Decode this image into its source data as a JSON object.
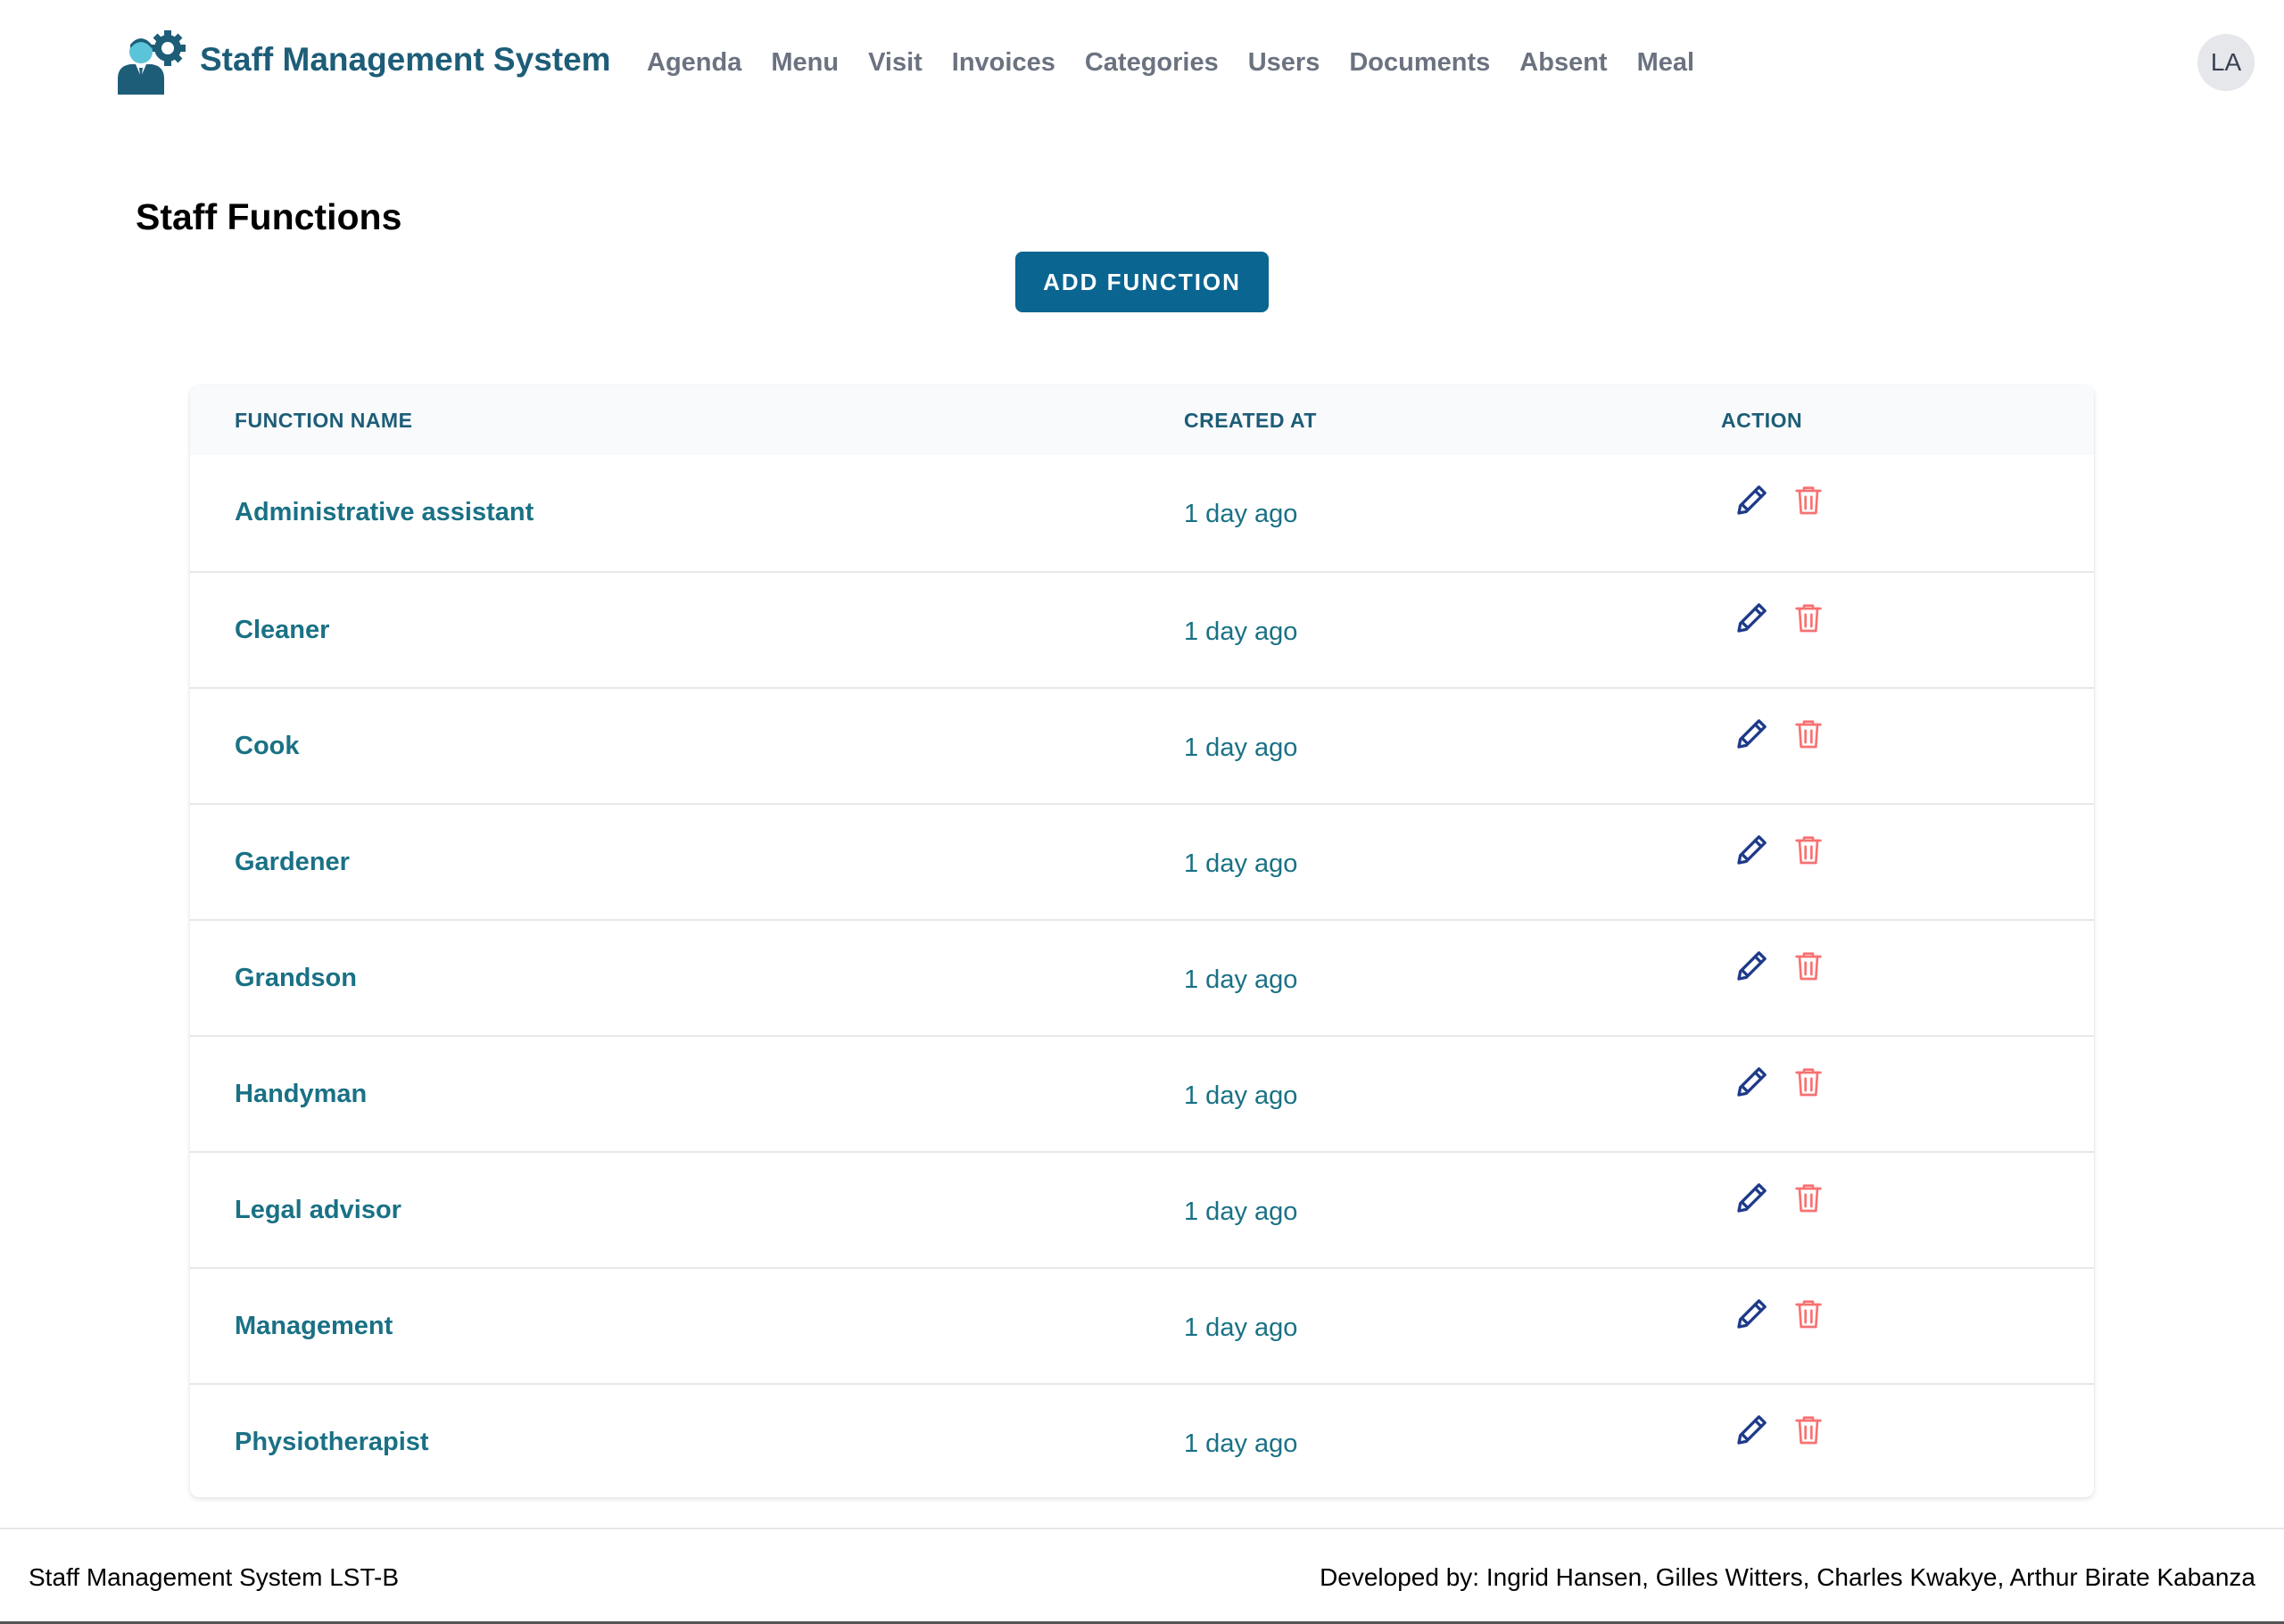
{
  "header": {
    "brand": "Staff Management System",
    "nav": [
      "Agenda",
      "Menu",
      "Visit",
      "Invoices",
      "Categories",
      "Users",
      "Documents",
      "Absent",
      "Meal"
    ],
    "avatar_initials": "LA"
  },
  "main": {
    "title": "Staff Functions",
    "add_button": "ADD FUNCTION",
    "table": {
      "columns": [
        "FUNCTION NAME",
        "CREATED AT",
        "ACTION"
      ],
      "rows": [
        {
          "name": "Administrative assistant",
          "created": "1 day ago"
        },
        {
          "name": "Cleaner",
          "created": "1 day ago"
        },
        {
          "name": "Cook",
          "created": "1 day ago"
        },
        {
          "name": "Gardener",
          "created": "1 day ago"
        },
        {
          "name": "Grandson",
          "created": "1 day ago"
        },
        {
          "name": "Handyman",
          "created": "1 day ago"
        },
        {
          "name": "Legal advisor",
          "created": "1 day ago"
        },
        {
          "name": "Management",
          "created": "1 day ago"
        },
        {
          "name": "Physiotherapist",
          "created": "1 day ago"
        }
      ]
    }
  },
  "footer": {
    "left": "Staff Management System LST-B",
    "right": "Developed by: Ingrid Hansen, Gilles Witters, Charles Kwakye, Arthur Birate Kabanza"
  },
  "icons": {
    "logo": "staff-logo-icon",
    "edit": "pencil-icon",
    "delete": "trash-icon"
  },
  "colors": {
    "brand": "#1d5d78",
    "button": "#0a6591",
    "link": "#1a7185",
    "edit_icon": "#1e3a8a",
    "delete_icon": "#f87171"
  }
}
